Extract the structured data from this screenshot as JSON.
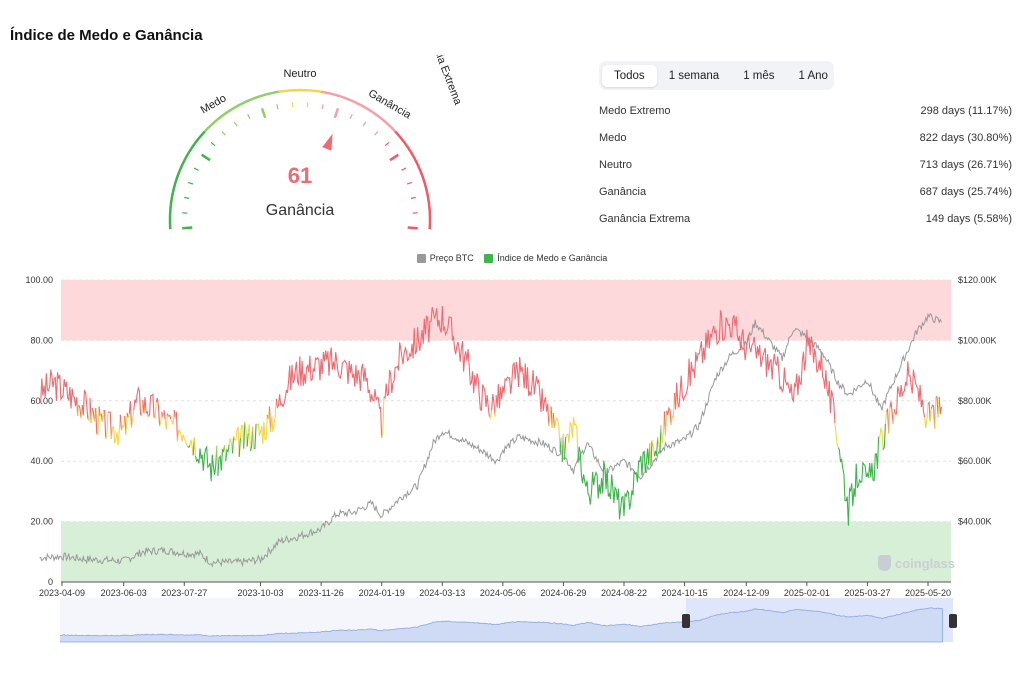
{
  "page_title": "Índice de Medo e Ganância",
  "gauge": {
    "value": 61,
    "value_label": "Ganância",
    "zones": [
      "Medo Extremo",
      "Medo",
      "Neutro",
      "Ganância",
      "Ganância Extrema"
    ],
    "colors": [
      "#3cb54a",
      "#8fcf6a",
      "#f5d547",
      "#f4a0a6",
      "#ef5a64"
    ]
  },
  "periods": [
    "Todos",
    "1 semana",
    "1 mês",
    "1 Ano"
  ],
  "active_period": "Todos",
  "stats": [
    {
      "label": "Medo Extremo",
      "value": "298 days (11.17%)"
    },
    {
      "label": "Medo",
      "value": "822 days (30.80%)"
    },
    {
      "label": "Neutro",
      "value": "713 days (26.71%)"
    },
    {
      "label": "Ganância",
      "value": "687 days (25.74%)"
    },
    {
      "label": "Ganância Extrema",
      "value": "149 days (5.58%)"
    }
  ],
  "brand": "coinglass",
  "colors": {
    "fear": "#3cb54a",
    "neutral": "#f5d547",
    "greed": "#f06a72",
    "price": "#999999",
    "greed_band": "#fdd9db",
    "fear_band": "#d7efd7"
  },
  "chart_data": {
    "type": "line",
    "legend": [
      "Preço BTC",
      "Índice de Medo e Ganância"
    ],
    "x_ticks": [
      "2023-04-09",
      "2023-06-03",
      "2023-07-27",
      "2023-10-03",
      "2023-11-26",
      "2024-01-19",
      "2024-03-13",
      "2024-05-06",
      "2024-06-29",
      "2024-08-22",
      "2024-10-15",
      "2024-12-09",
      "2025-02-01",
      "2025-03-27",
      "2025-05-20"
    ],
    "y_left": {
      "range": [
        0,
        100
      ],
      "ticks": [
        "0",
        "20.00",
        "40.00",
        "60.00",
        "80.00",
        "100.00"
      ]
    },
    "y_right": {
      "range": [
        20000,
        120000
      ],
      "ticks": [
        "$40.00K",
        "$60.00K",
        "$80.00K",
        "$100.00K",
        "$120.00K"
      ]
    },
    "bands": [
      {
        "from": 80,
        "to": 100,
        "zone": "greed"
      },
      {
        "from": 0,
        "to": 20,
        "zone": "fear"
      }
    ],
    "series": [
      {
        "name": "Índice de Medo e Ganância",
        "axis": "left",
        "x": [
          "2023-03-20",
          "2023-04-01",
          "2023-04-09",
          "2023-04-20",
          "2023-05-01",
          "2023-05-15",
          "2023-06-03",
          "2023-06-15",
          "2023-07-01",
          "2023-07-15",
          "2023-07-27",
          "2023-08-10",
          "2023-08-20",
          "2023-09-01",
          "2023-09-15",
          "2023-10-03",
          "2023-10-15",
          "2023-10-25",
          "2023-11-05",
          "2023-11-26",
          "2023-12-10",
          "2023-12-25",
          "2024-01-05",
          "2024-01-12",
          "2024-01-19",
          "2024-01-25",
          "2024-02-05",
          "2024-02-20",
          "2024-03-05",
          "2024-03-13",
          "2024-03-25",
          "2024-04-05",
          "2024-04-15",
          "2024-04-25",
          "2024-05-06",
          "2024-05-20",
          "2024-06-01",
          "2024-06-15",
          "2024-06-29",
          "2024-07-08",
          "2024-07-20",
          "2024-08-05",
          "2024-08-22",
          "2024-09-06",
          "2024-09-20",
          "2024-10-01",
          "2024-10-15",
          "2024-10-28",
          "2024-11-12",
          "2024-11-25",
          "2024-12-09",
          "2024-12-25",
          "2025-01-10",
          "2025-01-20",
          "2025-02-01",
          "2025-02-15",
          "2025-03-01",
          "2025-03-10",
          "2025-03-20",
          "2025-03-27",
          "2025-04-08",
          "2025-04-20",
          "2025-05-01",
          "2025-05-10",
          "2025-05-20",
          "2025-06-01"
        ],
        "values": [
          62,
          66,
          64,
          61,
          58,
          52,
          50,
          60,
          57,
          52,
          51,
          44,
          38,
          42,
          47,
          50,
          55,
          65,
          70,
          72,
          73,
          69,
          68,
          61,
          52,
          65,
          75,
          80,
          86,
          88,
          80,
          72,
          63,
          58,
          62,
          70,
          66,
          56,
          44,
          52,
          30,
          35,
          23,
          40,
          44,
          56,
          66,
          74,
          84,
          86,
          78,
          74,
          68,
          60,
          78,
          72,
          48,
          24,
          38,
          32,
          46,
          58,
          68,
          64,
          54,
          58
        ]
      },
      {
        "name": "Preço BTC",
        "axis": "right",
        "x": [
          "2023-03-20",
          "2023-04-09",
          "2023-05-01",
          "2023-06-03",
          "2023-06-20",
          "2023-07-10",
          "2023-07-27",
          "2023-08-10",
          "2023-08-20",
          "2023-09-15",
          "2023-10-03",
          "2023-10-20",
          "2023-11-05",
          "2023-11-26",
          "2023-12-10",
          "2023-12-25",
          "2024-01-10",
          "2024-01-19",
          "2024-02-05",
          "2024-02-20",
          "2024-03-05",
          "2024-03-13",
          "2024-03-25",
          "2024-04-15",
          "2024-05-01",
          "2024-05-06",
          "2024-05-20",
          "2024-06-10",
          "2024-06-29",
          "2024-07-08",
          "2024-07-20",
          "2024-08-05",
          "2024-08-22",
          "2024-09-06",
          "2024-09-28",
          "2024-10-15",
          "2024-10-28",
          "2024-11-12",
          "2024-11-25",
          "2024-12-09",
          "2024-12-17",
          "2025-01-10",
          "2025-01-20",
          "2025-02-01",
          "2025-02-15",
          "2025-03-01",
          "2025-03-10",
          "2025-03-27",
          "2025-04-08",
          "2025-04-20",
          "2025-05-01",
          "2025-05-10",
          "2025-05-20",
          "2025-06-01"
        ],
        "values": [
          28000,
          28500,
          27500,
          27000,
          30000,
          30500,
          29500,
          29300,
          26500,
          26500,
          27500,
          33500,
          35000,
          37500,
          42500,
          43000,
          46000,
          42000,
          48000,
          52000,
          66000,
          70000,
          68000,
          64000,
          60000,
          63500,
          68000,
          66000,
          62000,
          57000,
          66000,
          56000,
          60000,
          55000,
          65000,
          67000,
          72000,
          88000,
          95000,
          99000,
          106000,
          94000,
          104000,
          101000,
          96000,
          86000,
          82000,
          87000,
          77000,
          87000,
          96000,
          103000,
          108000,
          106000
        ]
      }
    ]
  }
}
